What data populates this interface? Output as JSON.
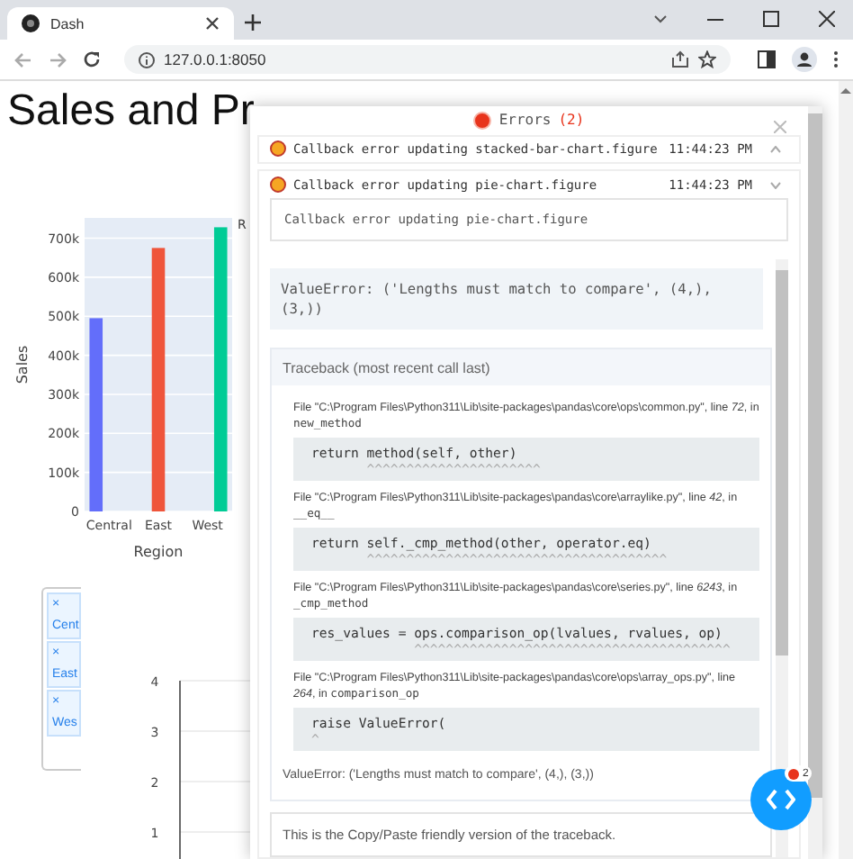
{
  "browser": {
    "tab_title": "Dash",
    "url": "127.0.0.1:8050"
  },
  "page": {
    "title": "Sales and Pr",
    "bar_chart": {
      "legend_title": "R",
      "chart_data": {
        "type": "bar",
        "xlabel": "Region",
        "ylabel": "Sales",
        "categories": [
          "Central",
          "East",
          "West"
        ],
        "series": [
          {
            "color": "#636efa",
            "values": [
              495000,
              null,
              null
            ]
          },
          {
            "color": "#ef553b",
            "values": [
              null,
              675000,
              null
            ]
          },
          {
            "color": "#00cc96",
            "values": [
              null,
              null,
              728000
            ]
          }
        ],
        "grid": true,
        "ylim": [
          0,
          752000
        ],
        "yticks": [
          {
            "value": 0,
            "label": "0"
          },
          {
            "value": 100000,
            "label": "100k"
          },
          {
            "value": 200000,
            "label": "200k"
          },
          {
            "value": 300000,
            "label": "300k"
          },
          {
            "value": 400000,
            "label": "400k"
          },
          {
            "value": 500000,
            "label": "500k"
          },
          {
            "value": 600000,
            "label": "600k"
          },
          {
            "value": 700000,
            "label": "700k"
          }
        ]
      }
    },
    "region_dropdown": {
      "chips": [
        {
          "remove": "×",
          "label": "Cent"
        },
        {
          "remove": "×",
          "label": "East"
        },
        {
          "remove": "×",
          "label": "Wes"
        }
      ]
    },
    "second_chart": {
      "yticks": [
        "4",
        "3",
        "2",
        "1"
      ]
    }
  },
  "error_overlay": {
    "title": "Errors",
    "count": "(2)",
    "errors": [
      {
        "message": "Callback error updating stacked-bar-chart.figure",
        "time": "11:44:23 PM",
        "expanded": false
      },
      {
        "message": "Callback error updating pie-chart.figure",
        "time": "11:44:23 PM",
        "expanded": true
      }
    ],
    "detail": {
      "message": "Callback error updating pie-chart.figure",
      "error_summary": "ValueError: ('Lengths must match to compare', (4,), (3,))",
      "traceback_title": "Traceback (most recent call last)",
      "frames": [
        {
          "location": "File \"C:\\Program Files\\Python311\\Lib\\site-packages\\pandas\\core\\ops\\common.py\", line *72*, in",
          "function": "new_method",
          "code": "return method(self, other)",
          "carets": "       ^^^^^^^^^^^^^^^^^^^^^^"
        },
        {
          "location": "File \"C:\\Program Files\\Python311\\Lib\\site-packages\\pandas\\core\\arraylike.py\", line *42*, in",
          "function": "__eq__",
          "code": "return self._cmp_method(other, operator.eq)",
          "carets": "       ^^^^^^^^^^^^^^^^^^^^^^^^^^^^^^^^^^^^^^"
        },
        {
          "location": "File \"C:\\Program Files\\Python311\\Lib\\site-packages\\pandas\\core\\series.py\", line *6243*, in",
          "function": "_cmp_method",
          "code": "res_values = ops.comparison_op(lvalues, rvalues, op)",
          "carets": "             ^^^^^^^^^^^^^^^^^^^^^^^^^^^^^^^^^^^^^^^^"
        },
        {
          "location": "File \"C:\\Program Files\\Python311\\Lib\\site-packages\\pandas\\core\\ops\\array_ops.py\", line *264*, in",
          "function": "comparison_op",
          "code": "raise ValueError(",
          "carets": "^"
        }
      ],
      "final_error": "ValueError: ('Lengths must match to compare', (4,), (3,))",
      "copy_paste_note": "This is the Copy/Paste friendly version of the traceback."
    }
  },
  "debug_button": {
    "error_count": "2"
  }
}
